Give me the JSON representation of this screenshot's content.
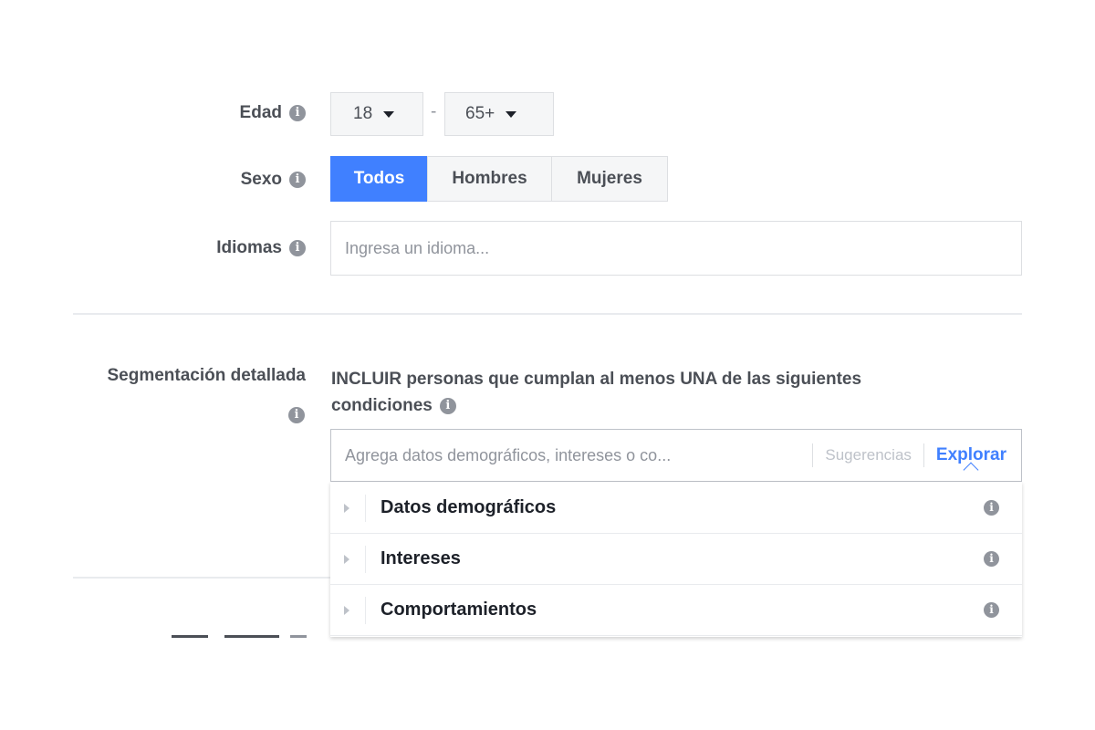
{
  "age": {
    "label": "Edad",
    "min_value": "18",
    "separator": "-",
    "max_value": "65+"
  },
  "gender": {
    "label": "Sexo",
    "options": [
      "Todos",
      "Hombres",
      "Mujeres"
    ],
    "selected": "Todos"
  },
  "languages": {
    "label": "Idiomas",
    "placeholder": "Ingresa un idioma..."
  },
  "detailed_targeting": {
    "label_line1": "Segmentación detallada",
    "include_text_line1": "INCLUIR personas que cumplan al menos UNA de las siguientes",
    "include_text_line2": "condiciones",
    "search_placeholder": "Agrega datos demográficos, intereses o co...",
    "suggestions_label": "Sugerencias",
    "browse_label": "Explorar",
    "categories": [
      "Datos demográficos",
      "Intereses",
      "Comportamientos"
    ]
  },
  "colors": {
    "accent": "#4080ff",
    "link": "#365899",
    "muted_text": "#90949c",
    "border": "#dddfe2"
  }
}
